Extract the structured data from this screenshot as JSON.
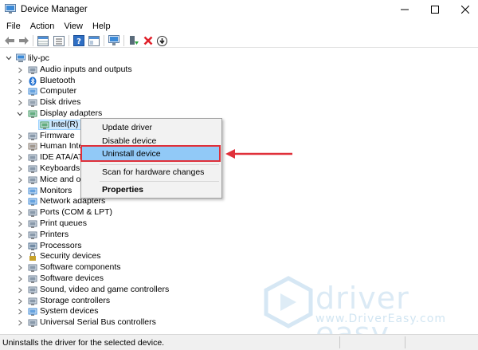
{
  "window": {
    "title": "Device Manager"
  },
  "menu": [
    "File",
    "Action",
    "View",
    "Help"
  ],
  "tree": {
    "root": "lily-pc",
    "items": [
      {
        "label": "Audio inputs and outputs",
        "icon": "speaker-icon"
      },
      {
        "label": "Bluetooth",
        "icon": "bluetooth-icon"
      },
      {
        "label": "Computer",
        "icon": "computer-icon"
      },
      {
        "label": "Disk drives",
        "icon": "disk-drive-icon"
      },
      {
        "label": "Display adapters",
        "icon": "display-adapter-icon",
        "expanded": true
      },
      {
        "label": "Firmware",
        "icon": "firmware-icon"
      },
      {
        "label": "Human Inte",
        "icon": "hid-icon"
      },
      {
        "label": "IDE ATA/ATA",
        "icon": "ide-icon"
      },
      {
        "label": "Keyboards",
        "icon": "keyboard-icon"
      },
      {
        "label": "Mice and oth",
        "icon": "mouse-icon"
      },
      {
        "label": "Monitors",
        "icon": "monitor-icon"
      },
      {
        "label": "Network adapters",
        "icon": "network-icon"
      },
      {
        "label": "Ports (COM & LPT)",
        "icon": "port-icon"
      },
      {
        "label": "Print queues",
        "icon": "printer-icon"
      },
      {
        "label": "Printers",
        "icon": "printer-icon"
      },
      {
        "label": "Processors",
        "icon": "processor-icon"
      },
      {
        "label": "Security devices",
        "icon": "security-icon"
      },
      {
        "label": "Software components",
        "icon": "software-component-icon"
      },
      {
        "label": "Software devices",
        "icon": "software-device-icon"
      },
      {
        "label": "Sound, video and game controllers",
        "icon": "sound-icon"
      },
      {
        "label": "Storage controllers",
        "icon": "storage-icon"
      },
      {
        "label": "System devices",
        "icon": "system-icon"
      },
      {
        "label": "Universal Serial Bus controllers",
        "icon": "usb-icon"
      }
    ],
    "child": {
      "label": "Intel(R) U",
      "icon": "display-adapter-icon"
    }
  },
  "context_menu": {
    "items": [
      "Update driver",
      "Disable device",
      "Uninstall device",
      "Scan for hardware changes",
      "Properties"
    ],
    "highlighted": "Uninstall device"
  },
  "watermark": {
    "brand": "driver easy",
    "url": "www.DriverEasy.com"
  },
  "status": {
    "text": "Uninstalls the driver for the selected device."
  },
  "colors": {
    "highlight": "#91c9f7",
    "annotation": "#e0303a",
    "selection": "#cde8ff"
  }
}
